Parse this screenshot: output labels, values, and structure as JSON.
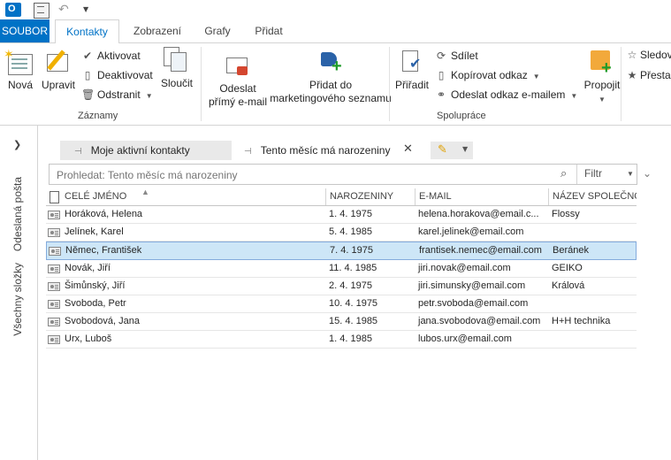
{
  "qat": {
    "app_icon": "outlook-icon",
    "sync_icon": "send-receive-icon",
    "undo_icon": "undo-icon",
    "customize_icon": "customize-qat-icon"
  },
  "tabs": {
    "file": "SOUBOR",
    "items": [
      "Kontakty",
      "Zobrazení",
      "Grafy",
      "Přidat"
    ],
    "active": "Kontakty"
  },
  "ribbon": {
    "zaznamy": {
      "label": "Záznamy",
      "nova": "Nová",
      "upravit": "Upravit",
      "aktivovat": "Aktivovat",
      "deaktivovat": "Deaktivovat",
      "odstranit": "Odstranit",
      "sloucit": "Sloučit"
    },
    "odeslat_line1": "Odeslat",
    "odeslat_line2": "přímý e-mail",
    "pridat_line1": "Přidat do",
    "pridat_line2": "marketingového seznamu",
    "spoluprace": {
      "label": "Spolupráce",
      "priradit": "Přiřadit",
      "sdilet": "Sdílet",
      "kopirovat": "Kopírovat odkaz",
      "odeslat_odkaz": "Odeslat odkaz e-mailem",
      "propojit": "Propojit"
    },
    "sledovat": "Sledov",
    "prestat": "Přesta"
  },
  "nav": {
    "expand_icon": "expand-chevron-icon",
    "items": [
      "Odeslaná pošta",
      "Všechny složky"
    ]
  },
  "views": {
    "tab1": "Moje aktivní kontakty",
    "tab2": "Tento měsíc má narozeniny"
  },
  "search": {
    "placeholder": "Prohledat: Tento měsíc má narozeniny",
    "filter_label": "Filtr"
  },
  "table": {
    "columns": [
      "CELÉ JMÉNO",
      "NAROZENINY",
      "E-MAIL",
      "NÁZEV SPOLEČNOS"
    ],
    "rows": [
      {
        "name": "Horáková, Helena",
        "birthday": "1. 4. 1975",
        "email": "helena.horakova@email.c...",
        "company": "Flossy"
      },
      {
        "name": "Jelínek, Karel",
        "birthday": "5. 4. 1985",
        "email": "karel.jelinek@email.com",
        "company": ""
      },
      {
        "name": "Němec, František",
        "birthday": "7. 4. 1975",
        "email": "frantisek.nemec@email.com",
        "company": "Beránek"
      },
      {
        "name": "Novák, Jiří",
        "birthday": "11. 4. 1985",
        "email": "jiri.novak@email.com",
        "company": "GEIKO"
      },
      {
        "name": "Šimůnský, Jiří",
        "birthday": "2. 4. 1975",
        "email": "jiri.simunsky@email.com",
        "company": "Králová"
      },
      {
        "name": "Svoboda, Petr",
        "birthday": "10. 4. 1975",
        "email": "petr.svoboda@email.com",
        "company": ""
      },
      {
        "name": "Svobodová, Jana",
        "birthday": "15. 4. 1985",
        "email": "jana.svobodova@email.com",
        "company": "H+H technika"
      },
      {
        "name": "Urx, Luboš",
        "birthday": "1. 4. 1985",
        "email": "lubos.urx@email.com",
        "company": ""
      }
    ],
    "selected_row": 2
  },
  "colors": {
    "accent": "#0072c6",
    "selection": "#cde6f7",
    "selection_border": "#84acdd"
  }
}
